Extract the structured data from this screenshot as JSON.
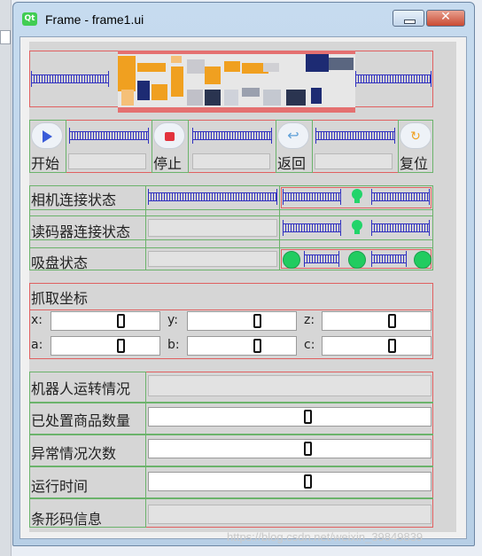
{
  "window": {
    "title": "Frame - frame1.ui",
    "logo_text": "Qt",
    "close_symbol": "✕"
  },
  "controls": [
    {
      "label": "开始",
      "icon": "play-icon",
      "color": "#3a5bd8"
    },
    {
      "label": "停止",
      "icon": "stop-icon",
      "color": "#e2323c"
    },
    {
      "label": "返回",
      "icon": "back-arrow-icon",
      "color": "#5fa0d8"
    },
    {
      "label": "复位",
      "icon": "reset-icon",
      "color": "#f0a020"
    }
  ],
  "status": {
    "camera": "相机连接状态",
    "reader": "读码器连接状态",
    "suction": "吸盘状态"
  },
  "coords": {
    "title": "抓取坐标",
    "labels": [
      "x:",
      "y:",
      "z:",
      "a:",
      "b:",
      "c:"
    ]
  },
  "info": {
    "robot": "机器人运转情况",
    "processed": "已处置商品数量",
    "errors": "异常情况次数",
    "runtime": "运行时间",
    "barcode": "条形码信息"
  },
  "watermark": "https://blog.csdn.net/weixin_39849839",
  "colors": {
    "accent_green": "#21cc60",
    "layout_red": "#e06060",
    "layout_green": "#6bb36b"
  }
}
